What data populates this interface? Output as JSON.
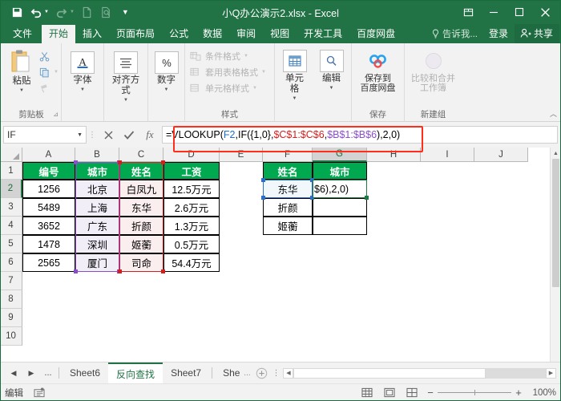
{
  "titlebar": {
    "title": "小Q办公演示2.xlsx - Excel",
    "qat": [
      {
        "name": "save-icon",
        "label": "保存"
      },
      {
        "name": "undo-icon",
        "label": "撤消"
      },
      {
        "name": "redo-icon",
        "label": "恢复"
      },
      {
        "name": "new-icon",
        "label": "新建"
      },
      {
        "name": "print-preview-icon",
        "label": "打印预览"
      },
      {
        "name": "customize-qat-icon",
        "label": "自定义快速访问工具栏"
      }
    ],
    "window_controls": [
      {
        "name": "ribbon-display-options",
        "label": "功能区显示选项"
      },
      {
        "name": "minimize-button",
        "label": "最小化"
      },
      {
        "name": "maximize-button",
        "label": "最大化"
      },
      {
        "name": "close-button",
        "label": "关闭"
      }
    ]
  },
  "ribbon_tabs": [
    {
      "label": "文件",
      "active": false
    },
    {
      "label": "开始",
      "active": true
    },
    {
      "label": "插入",
      "active": false
    },
    {
      "label": "页面布局",
      "active": false
    },
    {
      "label": "公式",
      "active": false
    },
    {
      "label": "数据",
      "active": false
    },
    {
      "label": "审阅",
      "active": false
    },
    {
      "label": "视图",
      "active": false
    },
    {
      "label": "开发工具",
      "active": false
    },
    {
      "label": "百度网盘",
      "active": false
    }
  ],
  "ribbon_right": {
    "tellme": "告诉我...",
    "signin": "登录",
    "share": "共享"
  },
  "ribbon_groups": [
    {
      "label": "剪贴板",
      "has_dialog_launcher": true,
      "big_buttons": [
        {
          "label": "粘贴",
          "icon": "paste-icon",
          "dropdown": true
        }
      ],
      "small_buttons": [
        {
          "label": "剪切",
          "icon": "cut-icon"
        },
        {
          "label": "复制",
          "icon": "copy-icon"
        },
        {
          "label": "格式刷",
          "icon": "format-painter-icon"
        }
      ]
    },
    {
      "label": "字体",
      "has_dialog_launcher": false,
      "big_buttons": [
        {
          "label": "字体",
          "icon": "font-icon",
          "dropdown": true
        }
      ],
      "small_buttons": []
    },
    {
      "label": "对齐方式",
      "has_dialog_launcher": false,
      "big_buttons": [
        {
          "label": "对齐方式",
          "icon": "alignment-icon",
          "dropdown": true
        }
      ],
      "small_buttons": []
    },
    {
      "label": "数字",
      "has_dialog_launcher": false,
      "big_buttons": [
        {
          "label": "数字",
          "icon": "percent-icon",
          "dropdown": true
        }
      ],
      "small_buttons": []
    },
    {
      "label": "样式",
      "has_dialog_launcher": false,
      "big_buttons": [],
      "small_buttons": [
        {
          "label": "条件格式",
          "icon": "conditional-format-icon",
          "disabled": true
        },
        {
          "label": "套用表格格式",
          "icon": "table-style-icon",
          "disabled": true
        },
        {
          "label": "单元格样式",
          "icon": "cell-style-icon",
          "disabled": true
        }
      ]
    },
    {
      "label": "",
      "has_dialog_launcher": false,
      "big_buttons": [
        {
          "label": "单元格",
          "icon": "cells-icon",
          "dropdown": true
        },
        {
          "label": "编辑",
          "icon": "editing-icon",
          "dropdown": true
        }
      ],
      "small_buttons": []
    },
    {
      "label": "保存",
      "has_dialog_launcher": false,
      "big_buttons": [
        {
          "label": "保存到\n百度网盘",
          "icon": "baidu-netdisk-icon",
          "dropdown": false
        }
      ],
      "small_buttons": []
    },
    {
      "label": "新建组",
      "has_dialog_launcher": false,
      "big_buttons": [
        {
          "label": "比较和合并\n工作簿",
          "icon": "compare-merge-icon",
          "dropdown": false,
          "disabled": true
        }
      ],
      "small_buttons": []
    }
  ],
  "formula_bar": {
    "name_box": "IF",
    "cancel_label": "取消",
    "enter_label": "输入",
    "fx_label": "插入函数",
    "formula": "=VLOOKUP(F2,IF({1,0},$C$1:$C$6,$B$1:$B$6),2,0)",
    "tokens": [
      {
        "t": "=VLOOKUP(",
        "c": "plain"
      },
      {
        "t": "F2",
        "c": "blue"
      },
      {
        "t": ",IF({1,0},",
        "c": "plain"
      },
      {
        "t": "$C$1:$C$6",
        "c": "red"
      },
      {
        "t": ",",
        "c": "plain"
      },
      {
        "t": "$B$1:$B$6",
        "c": "purple"
      },
      {
        "t": "),2,0)",
        "c": "plain"
      }
    ],
    "highlight_color": "#ff2d1a"
  },
  "grid": {
    "columns": [
      "A",
      "B",
      "C",
      "D",
      "E",
      "F",
      "G",
      "H",
      "I",
      "J"
    ],
    "selected_column": "G",
    "rows": [
      "1",
      "2",
      "3",
      "4",
      "5",
      "6",
      "7",
      "8",
      "9",
      "10"
    ],
    "selected_row": "2",
    "header_fill": "#00a94f",
    "table_left": {
      "headers": [
        "编号",
        "城市",
        "姓名",
        "工资"
      ],
      "rows": [
        [
          "1256",
          "北京",
          "白凤九",
          "12.5万元"
        ],
        [
          "5489",
          "上海",
          "东华",
          "2.6万元"
        ],
        [
          "3652",
          "广东",
          "折颜",
          "1.3万元"
        ],
        [
          "1478",
          "深圳",
          "姬蘅",
          "0.5万元"
        ],
        [
          "2565",
          "厦门",
          "司命",
          "54.4万元"
        ]
      ]
    },
    "table_right": {
      "headers": [
        "姓名",
        "城市"
      ],
      "rows": [
        [
          "东华",
          ""
        ],
        [
          "折颜",
          ""
        ],
        [
          "姬蘅",
          ""
        ]
      ]
    },
    "active_cell_text": "$6),2,0)",
    "range_colors": {
      "purple": "#8a4ecc",
      "red": "#d21f1f",
      "selection": "#2a6fc9",
      "edit": "#1a7a43"
    }
  },
  "sheet_tabs": {
    "nav": [
      "◀",
      "▶",
      "..."
    ],
    "tabs": [
      {
        "label": "Sheet6",
        "active": false
      },
      {
        "label": "反向查找",
        "active": true
      },
      {
        "label": "Sheet7",
        "active": false
      },
      {
        "label": "She",
        "active": false
      }
    ],
    "overflow": "...",
    "add_label": "新建工作表"
  },
  "status_bar": {
    "mode": "编辑",
    "macro_label": "宏录制",
    "views": [
      {
        "name": "normal-view-icon",
        "label": "普通"
      },
      {
        "name": "page-layout-view-icon",
        "label": "页面布局"
      },
      {
        "name": "page-break-view-icon",
        "label": "分页预览"
      }
    ],
    "zoom_out": "−",
    "zoom_in": "+",
    "zoom_level": "100%"
  }
}
